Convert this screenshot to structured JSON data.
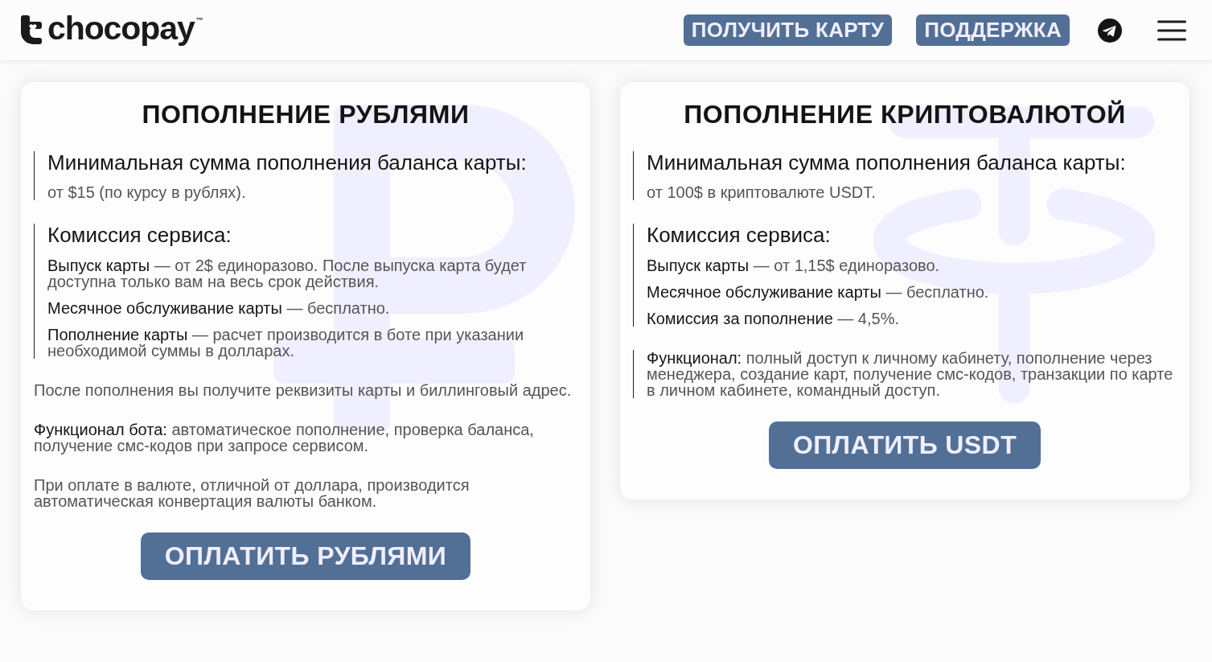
{
  "header": {
    "logo": {
      "text": "chocopay",
      "trademark": "™"
    },
    "buttons": [
      "ПОЛУЧИТЬ КАРТУ",
      "ПОДДЕРЖКА"
    ]
  },
  "cards": [
    {
      "kind": "rubles",
      "title": "ПОПОЛНЕНИЕ РУБЛЯМИ",
      "blocks": [
        {
          "kind": "section",
          "heading": "Минимальная сумма пополнения баланса карты:",
          "items": [
            "от $15 (по курсу в рублях)."
          ]
        },
        {
          "kind": "section",
          "heading": "Комиссия сервиса:",
          "items": [
            "**Выпуск карты** — от 2$ единоразово. После выпуска карта будет доступна только вам на весь срок действия.",
            "**Месячное обслуживание карты** — бесплатно.",
            "**Пополнение карты** — расчет производится в боте при указании необходимой суммы в долларах."
          ]
        },
        {
          "kind": "note",
          "text": "После пополнения вы получите реквизиты карты и биллинговый адрес."
        },
        {
          "kind": "note",
          "text": "**Функционал бота:** автоматическое пополнение, проверка баланса, получение смс-кодов при запросе сервисом."
        },
        {
          "kind": "note",
          "text": "При оплате в валюте, отличной от доллара, производится автоматическая конвертация валюты банком."
        }
      ],
      "button": "ОПЛАТИТЬ РУБЛЯМИ"
    },
    {
      "kind": "crypto",
      "title": "ПОПОЛНЕНИЕ КРИПТОВАЛЮТОЙ",
      "blocks": [
        {
          "kind": "section",
          "heading": "Минимальная сумма пополнения баланса карты:",
          "items": [
            "от 100$ в криптовалюте USDT."
          ]
        },
        {
          "kind": "section",
          "heading": "Комиссия сервиса:",
          "items": [
            "**Выпуск карты** — от 1,15$ единоразово.",
            "**Месячное обслуживание карты** — бесплатно.",
            "**Комиссия за пополнение** — 4,5%."
          ]
        },
        {
          "kind": "section",
          "items": [
            "**Функционал:** полный доступ к личному кабинету, пополнение через менеджера, создание карт, получение смс-кодов, транзакции по карте в личном кабинете, командный доступ."
          ]
        }
      ],
      "button": "ОПЛАТИТЬ USDT"
    }
  ]
}
